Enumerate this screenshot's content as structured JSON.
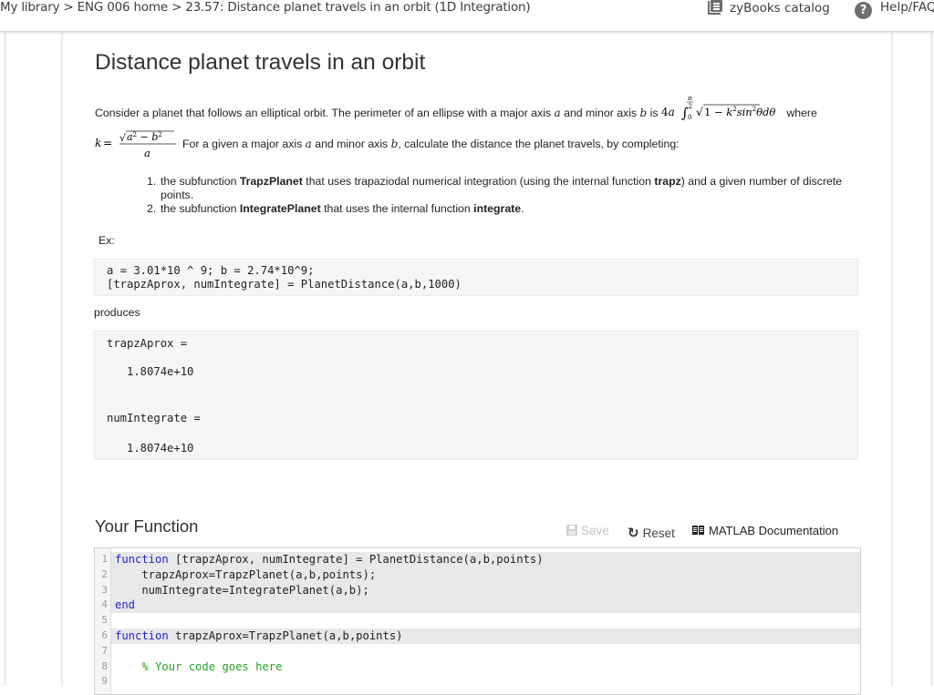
{
  "topbar": {
    "breadcrumb": [
      "My library",
      "ENG 006 home",
      "23.57: Distance planet travels in an orbit (1D Integration)"
    ],
    "separator": " > ",
    "catalog_label": "zyBooks catalog",
    "help_label": "Help/FAQ",
    "icons": {
      "catalog": "catalog-book-icon",
      "help": "help-question-icon"
    }
  },
  "problem": {
    "title": "Distance planet travels in an orbit",
    "intro_text_1": "Consider a planet that follows an elliptical orbit.  The perimeter of an ellipse with a major axis",
    "intro_a": "a",
    "intro_text_2": "and minor axis",
    "intro_b": "b",
    "intro_text_3": "is",
    "formula_perimeter": "4a ∫₀^{π/2} √(1 − k²sin²θ) dθ",
    "intro_text_4": "where",
    "formula_k": "k = √(a² − b²) / a",
    "given_text_1": "For a given a major axis",
    "given_a": "a",
    "given_text_2": "and minor axis",
    "given_b": "b",
    "given_text_3": ", calculate the distance the planet travels, by completing:",
    "tasks": [
      {
        "num": "1.",
        "pre": "the subfunction ",
        "bold1": "TrapzPlanet",
        "mid": " that uses trapaziodal numerical integration (using the internal function ",
        "bold2": "trapz",
        "post": ") and a given number of discrete points."
      },
      {
        "num": "2.",
        "pre": "the subfunction ",
        "bold1": "IntegratePlanet",
        "mid": " that uses the internal function ",
        "bold2": "integrate",
        "post": "."
      }
    ],
    "example_label": "Ex:",
    "example_code": [
      "a = 3.01*10 ^ 9; b = 2.74*10^9;",
      "[trapzAprox, numIntegrate] = PlanetDistance(a,b,1000)"
    ],
    "produces_label": "produces",
    "output": [
      "trapzAprox =",
      "   1.8074e+10",
      "numIntegrate =",
      "   1.8074e+10"
    ]
  },
  "your_function": {
    "title": "Your Function",
    "save_label": "Save",
    "reset_label": "Reset",
    "docs_label": "MATLAB Documentation",
    "save_enabled": false,
    "code_lines": [
      {
        "n": "1",
        "kw": "function",
        "text": " [trapzAprox, numIntegrate] = PlanetDistance(a,b,points)",
        "locked": true
      },
      {
        "n": "2",
        "kw": "",
        "text": "    trapzAprox=TrapzPlanet(a,b,points);",
        "locked": true
      },
      {
        "n": "3",
        "kw": "",
        "text": "    numIntegrate=IntegratePlanet(a,b);",
        "locked": true
      },
      {
        "n": "4",
        "kw": "end",
        "text": "",
        "locked": true
      },
      {
        "n": "5",
        "kw": "",
        "text": "",
        "locked": false
      },
      {
        "n": "6",
        "kw": "function",
        "text": " trapzAprox=TrapzPlanet(a,b,points)",
        "locked": true
      },
      {
        "n": "7",
        "kw": "",
        "text": "",
        "locked": false
      },
      {
        "n": "8",
        "kw": "",
        "comment": "    % Your code goes here",
        "text": "",
        "locked": false
      },
      {
        "n": "9",
        "kw": "",
        "text": "",
        "locked": false
      }
    ]
  },
  "colors": {
    "keyword": "#1f1fd8",
    "comment": "#27a327",
    "locked_line_bg": "#e8e8e8",
    "code_block_bg": "#f6f6f6"
  }
}
